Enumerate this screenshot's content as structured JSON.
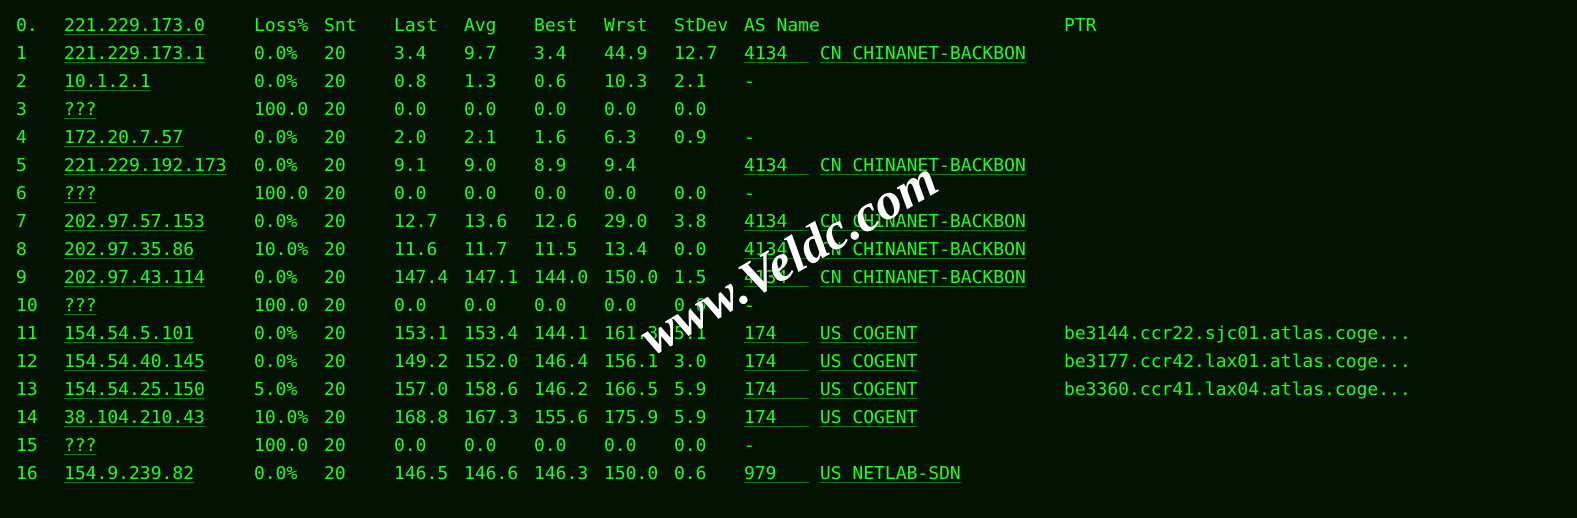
{
  "watermark": "www.Veldc.com",
  "header": {
    "hop": "0.",
    "ip": "221.229.173.0",
    "loss": "Loss%",
    "snt": "Snt",
    "last": "Last",
    "avg": "Avg",
    "best": "Best",
    "wrst": "Wrst",
    "stdev": "StDev",
    "as": "AS Name",
    "ptr": "PTR"
  },
  "rows": [
    {
      "hop": "1",
      "ip": "221.229.173.1",
      "loss": "0.0%",
      "snt": "20",
      "last": "3.4",
      "avg": "9.7",
      "best": "3.4",
      "wrst": "44.9",
      "stdev": "12.7",
      "as": "4134",
      "as_name": "CN CHINANET-BACKBON",
      "ptr": ""
    },
    {
      "hop": "2",
      "ip": "10.1.2.1",
      "loss": "0.0%",
      "snt": "20",
      "last": "0.8",
      "avg": "1.3",
      "best": "0.6",
      "wrst": "10.3",
      "stdev": "2.1",
      "as": "-",
      "as_name": "",
      "ptr": ""
    },
    {
      "hop": "3",
      "ip": "???",
      "loss": "100.0",
      "snt": "20",
      "last": "0.0",
      "avg": "0.0",
      "best": "0.0",
      "wrst": "0.0",
      "stdev": "0.0",
      "as": "",
      "as_name": "",
      "ptr": ""
    },
    {
      "hop": "4",
      "ip": "172.20.7.57",
      "loss": "0.0%",
      "snt": "20",
      "last": "2.0",
      "avg": "2.1",
      "best": "1.6",
      "wrst": "6.3",
      "stdev": "0.9",
      "as": "-",
      "as_name": "",
      "ptr": ""
    },
    {
      "hop": "5",
      "ip": "221.229.192.173",
      "loss": "0.0%",
      "snt": "20",
      "last": "9.1",
      "avg": "9.0",
      "best": "8.9",
      "wrst": "9.4",
      "stdev": "",
      "as": "4134",
      "as_name": "CN CHINANET-BACKBON",
      "ptr": ""
    },
    {
      "hop": "6",
      "ip": "???",
      "loss": "100.0",
      "snt": "20",
      "last": "0.0",
      "avg": "0.0",
      "best": "0.0",
      "wrst": "0.0",
      "stdev": "0.0",
      "as": "-",
      "as_name": "",
      "ptr": ""
    },
    {
      "hop": "7",
      "ip": "202.97.57.153",
      "loss": "0.0%",
      "snt": "20",
      "last": "12.7",
      "avg": "13.6",
      "best": "12.6",
      "wrst": "29.0",
      "stdev": "3.8",
      "as": "4134",
      "as_name": "CN CHINANET-BACKBON",
      "ptr": ""
    },
    {
      "hop": "8",
      "ip": "202.97.35.86",
      "loss": "10.0%",
      "snt": "20",
      "last": "11.6",
      "avg": "11.7",
      "best": "11.5",
      "wrst": "13.4",
      "stdev": "0.0",
      "as": "4134",
      "as_name": "CN CHINANET-BACKBON",
      "ptr": ""
    },
    {
      "hop": "9",
      "ip": "202.97.43.114",
      "loss": "0.0%",
      "snt": "20",
      "last": "147.4",
      "avg": "147.1",
      "best": "144.0",
      "wrst": "150.0",
      "stdev": "1.5",
      "as": "4134",
      "as_name": "CN CHINANET-BACKBON",
      "ptr": ""
    },
    {
      "hop": "10",
      "ip": "???",
      "loss": "100.0",
      "snt": "20",
      "last": "0.0",
      "avg": "0.0",
      "best": "0.0",
      "wrst": "0.0",
      "stdev": "0.0",
      "as": "-",
      "as_name": "",
      "ptr": ""
    },
    {
      "hop": "11",
      "ip": "154.54.5.101",
      "loss": "0.0%",
      "snt": "20",
      "last": "153.1",
      "avg": "153.4",
      "best": "144.1",
      "wrst": "161.3",
      "stdev": "5.1",
      "as": "174",
      "as_name": "US COGENT",
      "ptr": "be3144.ccr22.sjc01.atlas.coge..."
    },
    {
      "hop": "12",
      "ip": "154.54.40.145",
      "loss": "0.0%",
      "snt": "20",
      "last": "149.2",
      "avg": "152.0",
      "best": "146.4",
      "wrst": "156.1",
      "stdev": "3.0",
      "as": "174",
      "as_name": "US COGENT",
      "ptr": "be3177.ccr42.lax01.atlas.coge..."
    },
    {
      "hop": "13",
      "ip": "154.54.25.150",
      "loss": "5.0%",
      "snt": "20",
      "last": "157.0",
      "avg": "158.6",
      "best": "146.2",
      "wrst": "166.5",
      "stdev": "5.9",
      "as": "174",
      "as_name": "US COGENT",
      "ptr": "be3360.ccr41.lax04.atlas.coge..."
    },
    {
      "hop": "14",
      "ip": "38.104.210.43",
      "loss": "10.0%",
      "snt": "20",
      "last": "168.8",
      "avg": "167.3",
      "best": "155.6",
      "wrst": "175.9",
      "stdev": "5.9",
      "as": "174",
      "as_name": "US COGENT",
      "ptr": ""
    },
    {
      "hop": "15",
      "ip": "???",
      "loss": "100.0",
      "snt": "20",
      "last": "0.0",
      "avg": "0.0",
      "best": "0.0",
      "wrst": "0.0",
      "stdev": "0.0",
      "as": "-",
      "as_name": "",
      "ptr": ""
    },
    {
      "hop": "16",
      "ip": "154.9.239.82",
      "loss": "0.0%",
      "snt": "20",
      "last": "146.5",
      "avg": "146.6",
      "best": "146.3",
      "wrst": "150.0",
      "stdev": "0.6",
      "as": "979",
      "as_name": "US NETLAB-SDN",
      "ptr": ""
    }
  ]
}
